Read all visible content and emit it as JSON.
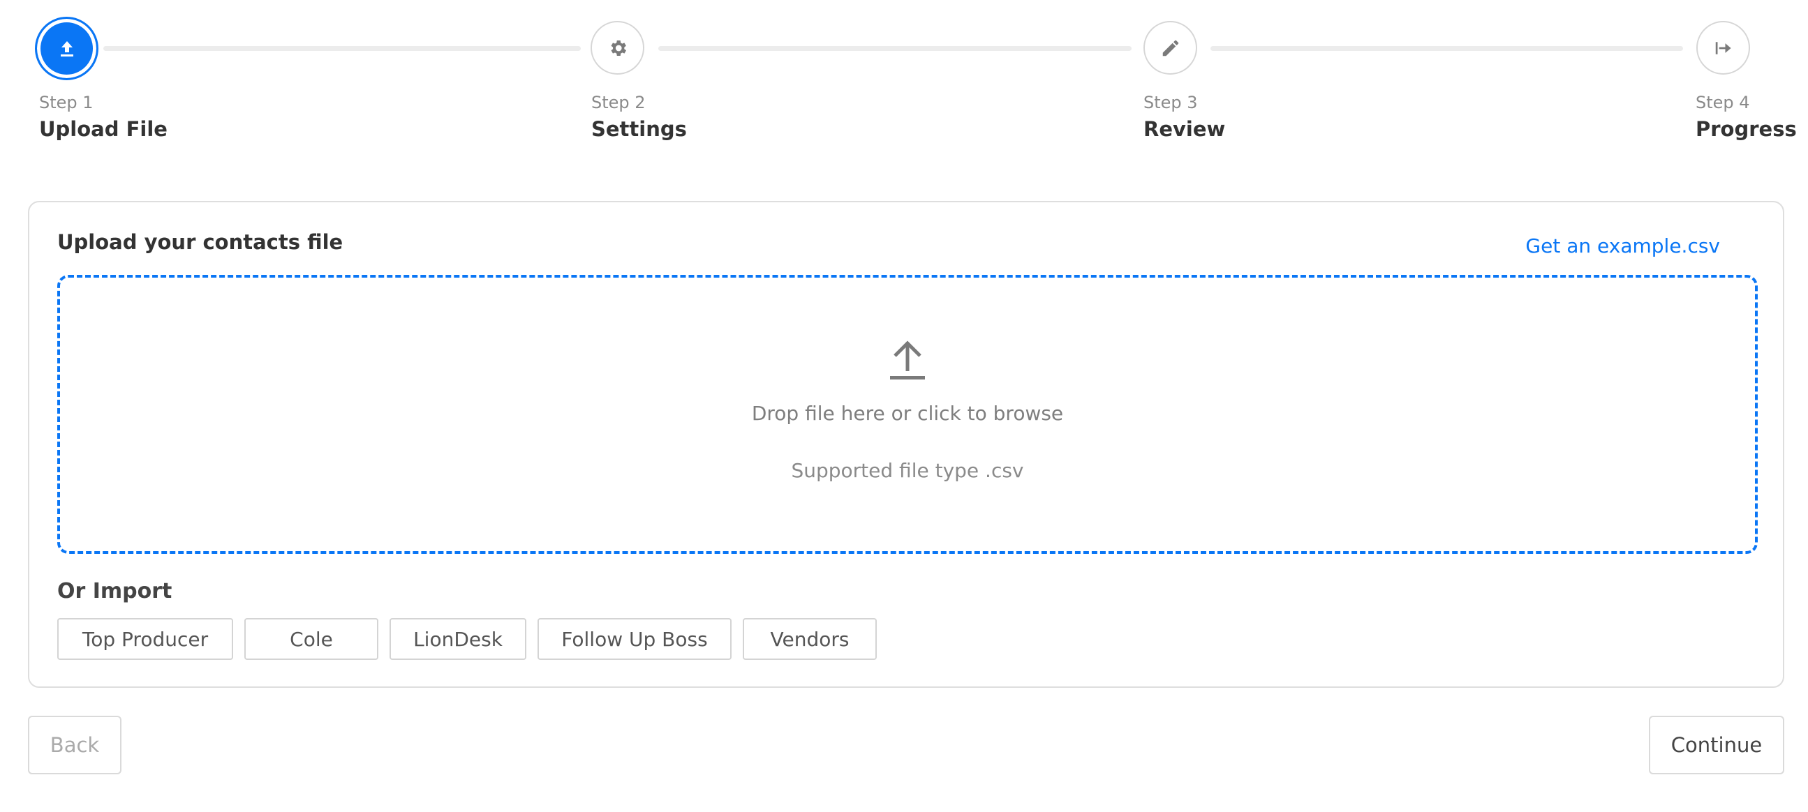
{
  "colors": {
    "accent": "#0a76f5",
    "inactive_border": "#d6d6d6",
    "track": "#ececec"
  },
  "stepper": {
    "steps": [
      {
        "number_label": "Step 1",
        "title": "Upload File",
        "icon": "upload-icon",
        "state": "active"
      },
      {
        "number_label": "Step 2",
        "title": "Settings",
        "icon": "gear-icon",
        "state": "inactive"
      },
      {
        "number_label": "Step 3",
        "title": "Review",
        "icon": "pencil-icon",
        "state": "inactive"
      },
      {
        "number_label": "Step 4",
        "title": "Progress",
        "icon": "arrow-right-to-line-icon",
        "state": "inactive"
      }
    ]
  },
  "upload": {
    "title": "Upload your contacts file",
    "example_link": "Get an example.csv",
    "dropzone": {
      "icon": "upload-arrow-icon",
      "instruction": "Drop file here or click to browse",
      "supported": "Supported file type .csv"
    }
  },
  "import": {
    "title": "Or Import",
    "sources": [
      "Top Producer",
      "Cole",
      "LionDesk",
      "Follow Up Boss",
      "Vendors"
    ]
  },
  "footer": {
    "back_label": "Back",
    "continue_label": "Continue",
    "back_disabled": true
  }
}
